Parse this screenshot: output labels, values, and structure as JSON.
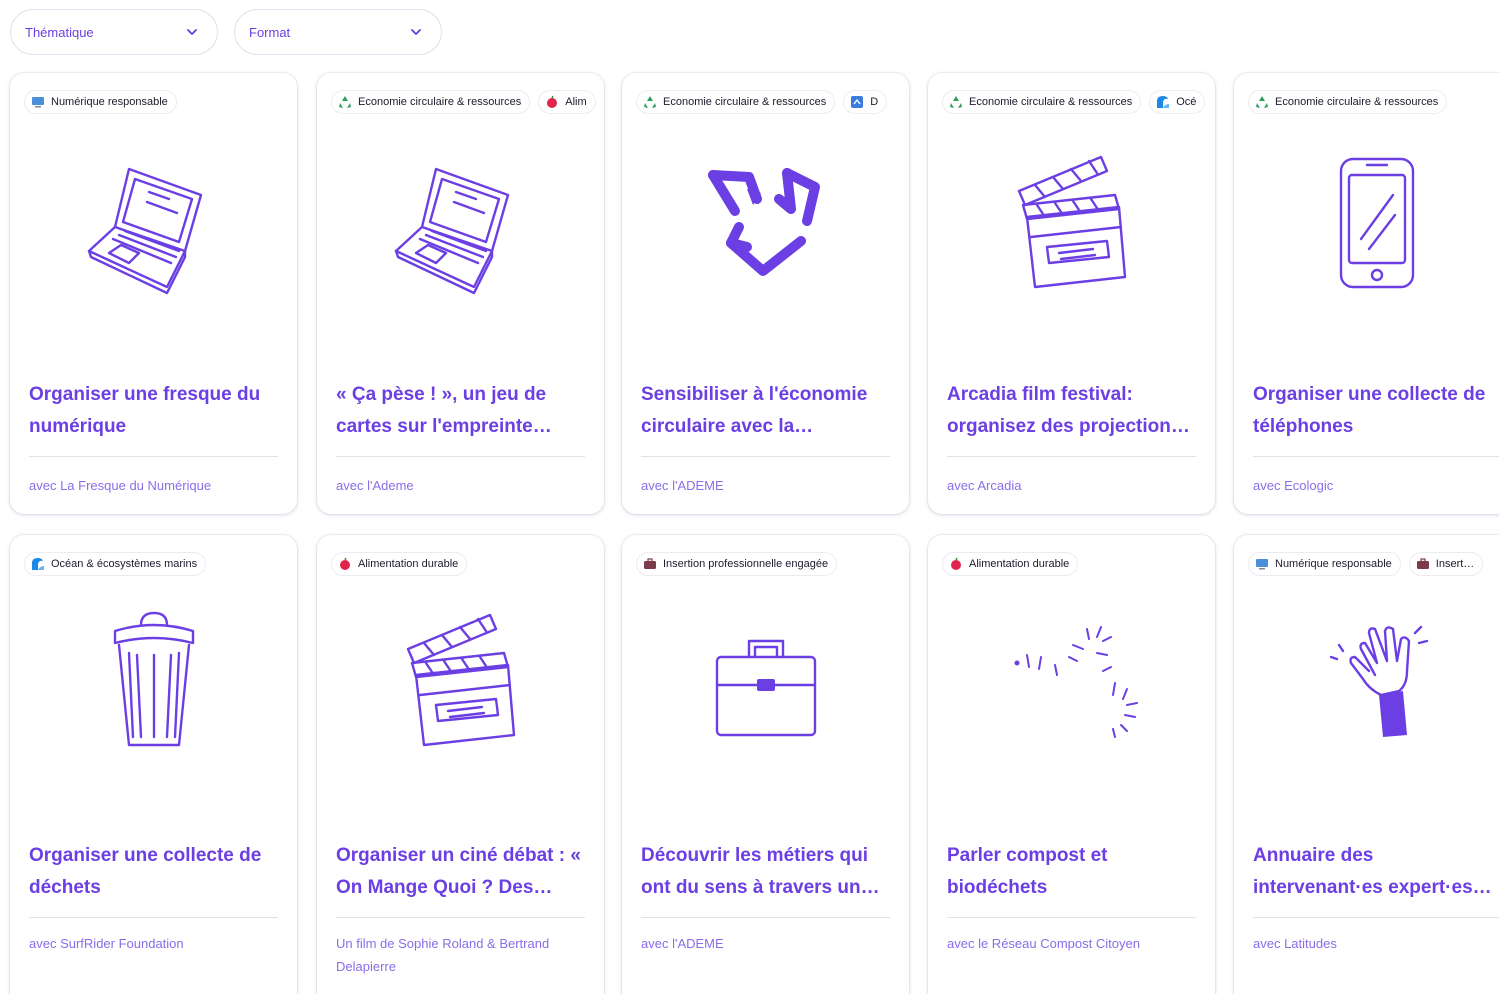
{
  "filters": {
    "thematique": "Thématique",
    "format": "Format"
  },
  "colors": {
    "accent": "#6b3fe3",
    "muted": "#8a6de8"
  },
  "cards": [
    {
      "tags": [
        {
          "label": "Numérique responsable",
          "icon": "computer-screen-icon"
        }
      ],
      "illustration": "laptop-icon",
      "title": "Organiser une fresque du numérique",
      "author": "avec La Fresque du Numérique"
    },
    {
      "tags": [
        {
          "label": "Economie circulaire & ressources",
          "icon": "recycle-icon"
        },
        {
          "label": "Alim",
          "icon": "apple-icon"
        }
      ],
      "illustration": "laptop-icon",
      "title": "« Ça pèse ! », un jeu de cartes sur l'empreinte…",
      "author": "avec l'Ademe"
    },
    {
      "tags": [
        {
          "label": "Economie circulaire & ressources",
          "icon": "recycle-icon"
        },
        {
          "label": "D",
          "icon": "blue-square-icon"
        }
      ],
      "illustration": "recycle-arrows-icon",
      "title": "Sensibiliser à l'économie circulaire avec la…",
      "author": "avec l'ADEME"
    },
    {
      "tags": [
        {
          "label": "Economie circulaire & ressources",
          "icon": "recycle-icon"
        },
        {
          "label": "Océ",
          "icon": "wave-icon"
        }
      ],
      "illustration": "clapperboard-icon",
      "title": "Arcadia film festival: organisez des projection…",
      "author": "avec Arcadia"
    },
    {
      "tags": [
        {
          "label": "Economie circulaire & ressources",
          "icon": "recycle-icon"
        }
      ],
      "illustration": "smartphone-icon",
      "title": "Organiser une collecte de téléphones",
      "author": "avec Ecologic"
    },
    {
      "tags": [
        {
          "label": "Océan & écosystèmes marins",
          "icon": "wave-icon"
        }
      ],
      "illustration": "trash-can-icon",
      "title": "Organiser une collecte de déchets",
      "author": "avec SurfRider Foundation"
    },
    {
      "tags": [
        {
          "label": "Alimentation durable",
          "icon": "apple-icon"
        }
      ],
      "illustration": "clapperboard-icon",
      "title": "Organiser un ciné débat : « On Mange Quoi ? Des…",
      "author": "Un film de Sophie Roland & Bertrand Delapierre"
    },
    {
      "tags": [
        {
          "label": "Insertion professionnelle engagée",
          "icon": "briefcase-icon"
        }
      ],
      "illustration": "toolbox-icon",
      "title": "Découvrir les métiers qui ont du sens à travers un…",
      "author": "avec l'ADEME"
    },
    {
      "tags": [
        {
          "label": "Alimentation durable",
          "icon": "apple-icon"
        }
      ],
      "illustration": "worm-icon",
      "title": "Parler compost et biodéchets",
      "author": "avec le Réseau Compost Citoyen"
    },
    {
      "tags": [
        {
          "label": "Numérique responsable",
          "icon": "computer-screen-icon"
        },
        {
          "label": "Insert…",
          "icon": "briefcase-icon"
        }
      ],
      "illustration": "waving-hand-icon",
      "title": "Annuaire des intervenant·es expert·es…",
      "author": "avec Latitudes"
    }
  ]
}
